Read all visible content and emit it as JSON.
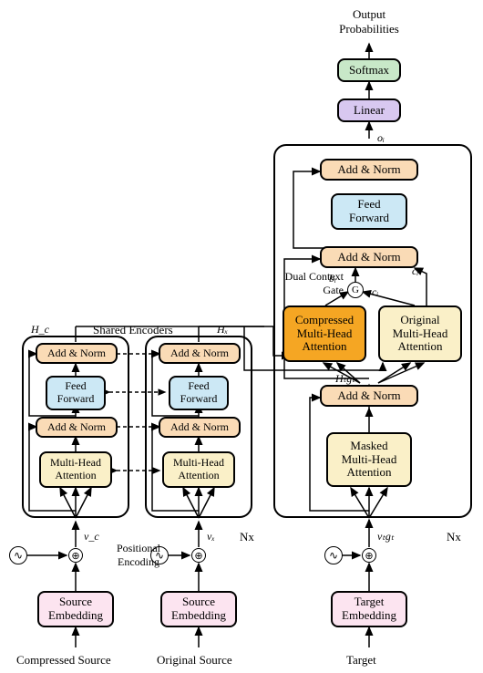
{
  "top": {
    "output": "Output\nProbabilities",
    "softmax": "Softmax",
    "linear": "Linear",
    "oi": "oᵢ"
  },
  "decoder": {
    "addnorm3": "Add & Norm",
    "feedforward": "Feed\nForward",
    "addnorm2": "Add & Norm",
    "compressed_mha": "Compressed\nMulti-Head\nAttention",
    "original_mha": "Original\nMulti-Head\nAttention",
    "addnorm1": "Add & Norm",
    "masked_mha": "Masked\nMulti-Head\nAttention",
    "gate_label": "Dual Context\nGate",
    "bi": "bᵢ",
    "ci_prime": "cᵢ′",
    "ci": "cᵢ",
    "htgt": "Hₜgₜ",
    "vtgt": "vₜgₜ",
    "nx": "Nx",
    "target_embed": "Target\nEmbedding",
    "target_label": "Target"
  },
  "encoders": {
    "shared_label": "Shared Encoders",
    "hc": "H_c",
    "hx": "Hₓ",
    "addnorm2": "Add & Norm",
    "feedforward": "Feed\nForward",
    "addnorm1": "Add & Norm",
    "mha": "Multi-Head\nAttention",
    "vc": "v_c",
    "vx": "vₓ",
    "nx": "Nx",
    "pos_enc": "Positional\nEncoding",
    "source_embed": "Source\nEmbedding",
    "compressed_label": "Compressed Source",
    "original_label": "Original Source"
  },
  "gate_symbol": "G",
  "plus": "⊕",
  "sine": "∿"
}
